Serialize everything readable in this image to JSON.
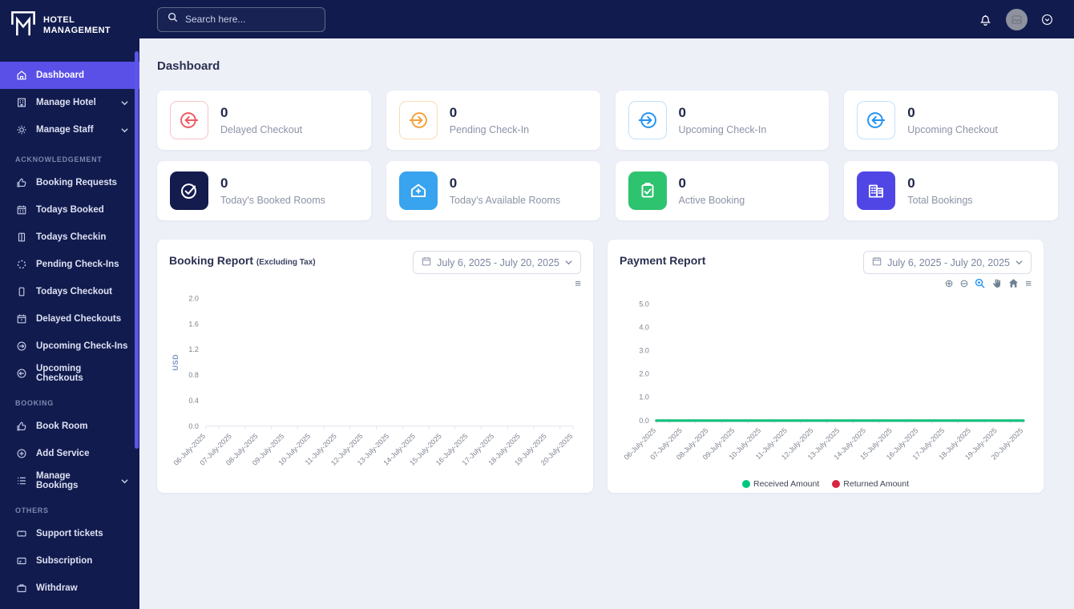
{
  "colors": {
    "navy": "#111b4e",
    "accent_purple": "#5a50e8",
    "red": "#ee5a63",
    "orange": "#f5a03c",
    "blue": "#2493f2",
    "cyan": "#38a3ee",
    "green_fill": "#2ec36f",
    "indigo": "#4f46e5",
    "chart_green": "#00c77e",
    "chart_red": "#d7263d"
  },
  "brand": {
    "line1": "HOTEL",
    "line2": "MANAGEMENT"
  },
  "topbar": {
    "search_placeholder": "Search here...",
    "icons": [
      "search-icon",
      "notification-bell-icon",
      "user-avatar",
      "account-dropdown-icon"
    ]
  },
  "sidebar": {
    "sections": [
      {
        "items": [
          {
            "label": "Dashboard",
            "icon": "home-icon"
          },
          {
            "label": "Manage Hotel",
            "icon": "building-icon"
          },
          {
            "label": "Manage Staff",
            "icon": "gear-icon"
          }
        ]
      },
      {
        "label": "ACKNOWLEDGEMENT",
        "items": [
          {
            "label": "Booking Requests",
            "icon": "thumbs-up-icon"
          },
          {
            "label": "Todays Booked",
            "icon": "calendar-grid-icon"
          },
          {
            "label": "Todays Checkin",
            "icon": "door-enter-icon"
          },
          {
            "label": "Pending Check-Ins",
            "icon": "spinner-icon"
          },
          {
            "label": "Todays Checkout",
            "icon": "door-icon"
          },
          {
            "label": "Delayed Checkouts",
            "icon": "calendar-alert-icon"
          },
          {
            "label": "Upcoming Check-Ins",
            "icon": "arrow-right-circle-icon"
          },
          {
            "label": "Upcoming Checkouts",
            "icon": "arrow-left-circle-icon"
          }
        ]
      },
      {
        "label": "BOOKING",
        "items": [
          {
            "label": "Book Room",
            "icon": "thumbs-up-icon"
          },
          {
            "label": "Add Service",
            "icon": "plus-circle-icon"
          },
          {
            "label": "Manage Bookings",
            "icon": "list-icon"
          }
        ]
      },
      {
        "label": "OTHERS",
        "items": [
          {
            "label": "Support tickets",
            "icon": "ticket-icon"
          },
          {
            "label": "Subscription",
            "icon": "credit-card-icon"
          },
          {
            "label": "Withdraw",
            "icon": "briefcase-icon"
          }
        ]
      }
    ]
  },
  "page": {
    "title": "Dashboard"
  },
  "stats": [
    {
      "value": "0",
      "label": "Delayed Checkout",
      "icon": "exit-arrow-circle-icon",
      "variant": "outline-red"
    },
    {
      "value": "0",
      "label": "Pending Check-In",
      "icon": "enter-arrow-circle-icon",
      "variant": "outline-orange"
    },
    {
      "value": "0",
      "label": "Upcoming Check-In",
      "icon": "enter-arrow-circle-icon",
      "variant": "outline-blue"
    },
    {
      "value": "0",
      "label": "Upcoming Checkout",
      "icon": "exit-arrow-circle-icon",
      "variant": "outline-blue"
    },
    {
      "value": "0",
      "label": "Today's Booked Rooms",
      "icon": "check-circle-icon",
      "variant": "fill-navy"
    },
    {
      "value": "0",
      "label": "Today's Available Rooms",
      "icon": "home-plus-icon",
      "variant": "fill-cyan"
    },
    {
      "value": "0",
      "label": "Active Booking",
      "icon": "clipboard-check-icon",
      "variant": "fill-green"
    },
    {
      "value": "0",
      "label": "Total Bookings",
      "icon": "buildings-icon",
      "variant": "fill-indigo"
    }
  ],
  "chart_data": [
    {
      "type": "line",
      "title": "Booking Report",
      "subtitle": "(Excluding Tax)",
      "date_range": "July 6, 2025 - July 20, 2025",
      "ylabel": "USD",
      "ylim": [
        0,
        2
      ],
      "yticks": [
        2.0,
        1.6,
        1.2,
        0.8,
        0.4,
        0.0
      ],
      "categories": [
        "06-July-2025",
        "07-July-2025",
        "08-July-2025",
        "09-July-2025",
        "10-July-2025",
        "11-July-2025",
        "12-July-2025",
        "13-July-2025",
        "14-July-2025",
        "15-July-2025",
        "16-July-2025",
        "17-July-2025",
        "18-July-2025",
        "19-July-2025",
        "20-July-2025"
      ],
      "series": [],
      "grid": false,
      "legend_position": "none",
      "toolbar": [
        "menu-icon"
      ]
    },
    {
      "type": "line",
      "title": "Payment Report",
      "date_range": "July 6, 2025 - July 20, 2025",
      "ylabel": "",
      "ylim": [
        0,
        5
      ],
      "yticks": [
        5.0,
        4.0,
        3.0,
        2.0,
        1.0,
        0.0
      ],
      "categories": [
        "06-July-2025",
        "07-July-2025",
        "08-July-2025",
        "09-July-2025",
        "10-July-2025",
        "11-July-2025",
        "12-July-2025",
        "13-July-2025",
        "14-July-2025",
        "15-July-2025",
        "16-July-2025",
        "17-July-2025",
        "18-July-2025",
        "19-July-2025",
        "20-July-2025"
      ],
      "series": [
        {
          "name": "Received Amount",
          "color": "#00c77e",
          "values": [
            0,
            0,
            0,
            0,
            0,
            0,
            0,
            0,
            0,
            0,
            0,
            0,
            0,
            0,
            0
          ]
        },
        {
          "name": "Returned Amount",
          "color": "#d7263d",
          "values": [
            0,
            0,
            0,
            0,
            0,
            0,
            0,
            0,
            0,
            0,
            0,
            0,
            0,
            0,
            0
          ]
        }
      ],
      "grid": false,
      "legend_position": "bottom",
      "toolbar": [
        "zoom-in-icon",
        "zoom-out-icon",
        "selection-zoom-icon",
        "pan-icon",
        "home-reset-icon",
        "menu-icon"
      ]
    }
  ]
}
